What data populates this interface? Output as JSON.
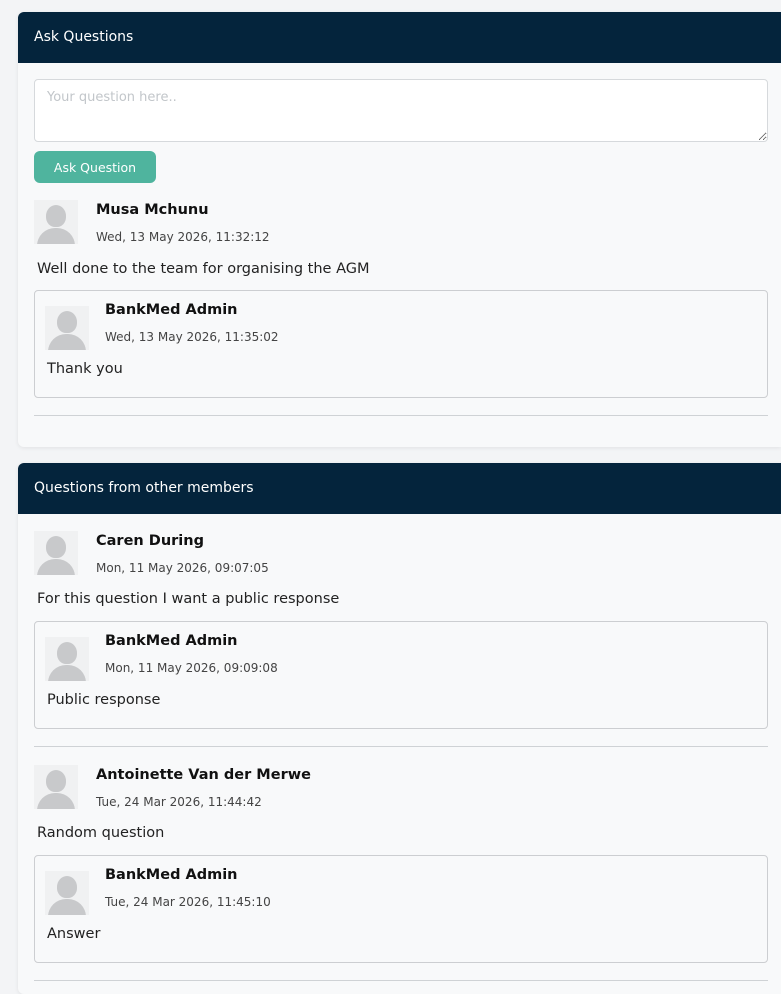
{
  "ask_section": {
    "header": "Ask Questions",
    "placeholder": "Your question here..",
    "button_label": "Ask Question",
    "questions": [
      {
        "author": "Musa Mchunu",
        "date": "Wed, 13 May 2026, 11:32:12",
        "text": "Well done to the team for organising the AGM",
        "reply": {
          "author": "BankMed Admin",
          "date": "Wed, 13 May 2026, 11:35:02",
          "text": "Thank you"
        }
      }
    ]
  },
  "others_section": {
    "header": "Questions from other members",
    "questions": [
      {
        "author": "Caren During",
        "date": "Mon, 11 May 2026, 09:07:05",
        "text": "For this question I want a public response",
        "reply": {
          "author": "BankMed Admin",
          "date": "Mon, 11 May 2026, 09:09:08",
          "text": "Public response"
        }
      },
      {
        "author": "Antoinette Van der Merwe",
        "date": "Tue, 24 Mar 2026, 11:44:42",
        "text": "Random question",
        "reply": {
          "author": "BankMed Admin",
          "date": "Tue, 24 Mar 2026, 11:45:10",
          "text": "Answer"
        }
      }
    ]
  },
  "colors": {
    "header_bg": "#04243c",
    "button_bg": "#4fb49e",
    "avatar": "#c8c9cb"
  },
  "icons": {
    "avatar": "user-placeholder-icon"
  }
}
